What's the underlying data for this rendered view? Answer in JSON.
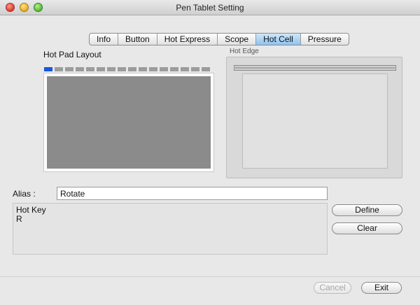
{
  "window": {
    "title": "Pen Tablet Setting"
  },
  "tabs": [
    {
      "label": "Info"
    },
    {
      "label": "Button"
    },
    {
      "label": "Hot Express"
    },
    {
      "label": "Scope"
    },
    {
      "label": "Hot Cell",
      "active": true
    },
    {
      "label": "Pressure"
    }
  ],
  "hot_pad": {
    "label": "Hot Pad Layout",
    "cell_count": 16,
    "selected_cell": 1
  },
  "hot_edge": {
    "label": "Hot Edge"
  },
  "alias": {
    "label": "Alias :",
    "value": "Rotate"
  },
  "hotkey": {
    "label": "Hot Key",
    "value": "R"
  },
  "buttons": {
    "define": "Define",
    "clear": "Clear",
    "cancel": "Cancel",
    "exit": "Exit"
  },
  "colors": {
    "active_tab": "#8fc3f0",
    "selected_cell": "#1a56d8",
    "pad_fill": "#8b8b8b"
  }
}
